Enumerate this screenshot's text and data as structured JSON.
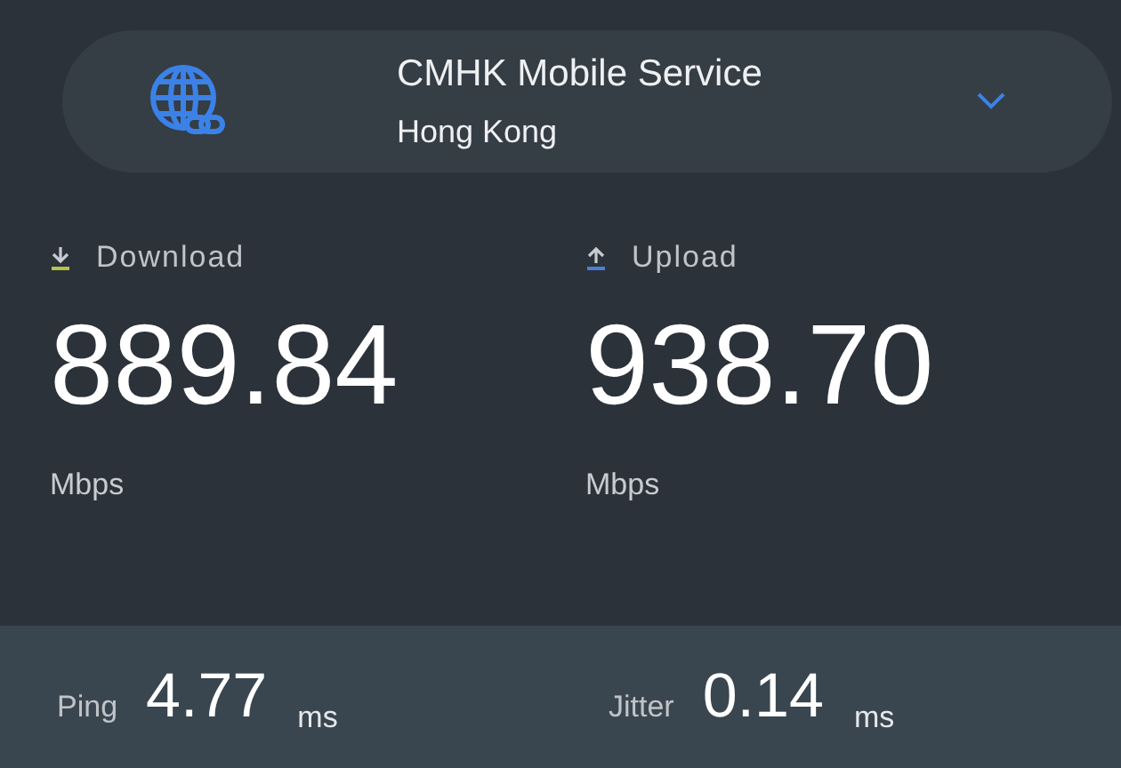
{
  "server": {
    "name": "CMHK Mobile Service",
    "location": "Hong Kong"
  },
  "results": [
    {
      "kind": "download",
      "label": "Download",
      "value": "889.84",
      "unit": "Mbps"
    },
    {
      "kind": "upload",
      "label": "Upload",
      "value": "938.70",
      "unit": "Mbps"
    }
  ],
  "latency": [
    {
      "label": "Ping",
      "value": "4.77",
      "unit": "ms"
    },
    {
      "label": "Jitter",
      "value": "0.14",
      "unit": "ms"
    }
  ]
}
